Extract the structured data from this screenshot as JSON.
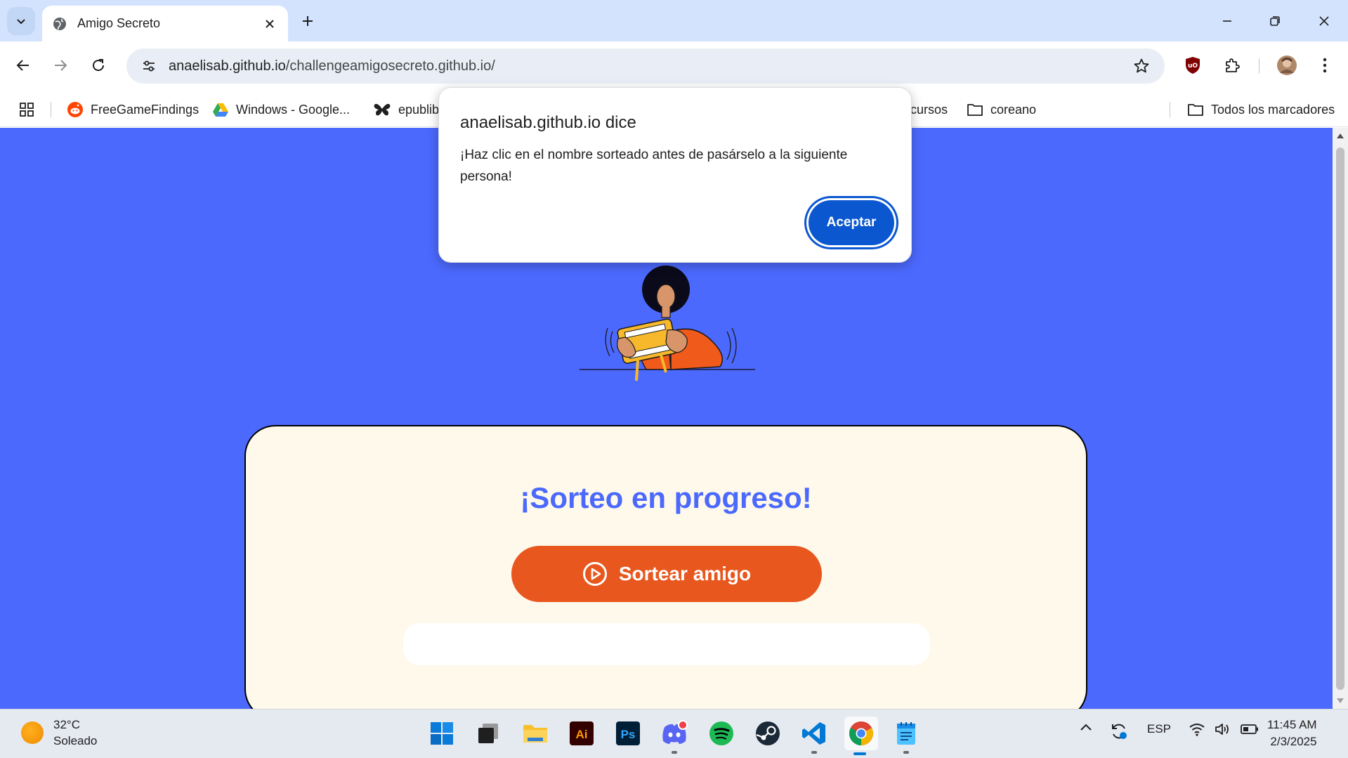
{
  "browser": {
    "tab_title": "Amigo Secreto",
    "url_host": "anaelisab.github.io",
    "url_path": "/challengeamigosecreto.github.io/"
  },
  "bookmarks": {
    "items": [
      "FreeGameFindings",
      "Windows - Google...",
      "epublib",
      "cursos",
      "coreano"
    ],
    "all_bookmarks": "Todos los marcadores"
  },
  "page": {
    "title": "¡Sorteo en progreso!",
    "draw_button": "Sortear amigo"
  },
  "dialog": {
    "title": "anaelisab.github.io dice",
    "message": "¡Haz clic en el nombre sorteado antes de pasárselo a la siguiente persona!",
    "ok_label": "Aceptar"
  },
  "taskbar": {
    "weather_temp": "32°C",
    "weather_desc": "Soleado",
    "language": "ESP",
    "time": "11:45 AM",
    "date": "2/3/2025"
  },
  "colors": {
    "page_bg": "#4b69fd",
    "card_bg": "#fff9eb",
    "accent_orange": "#e8571e",
    "dialog_button": "#0b57d0"
  }
}
